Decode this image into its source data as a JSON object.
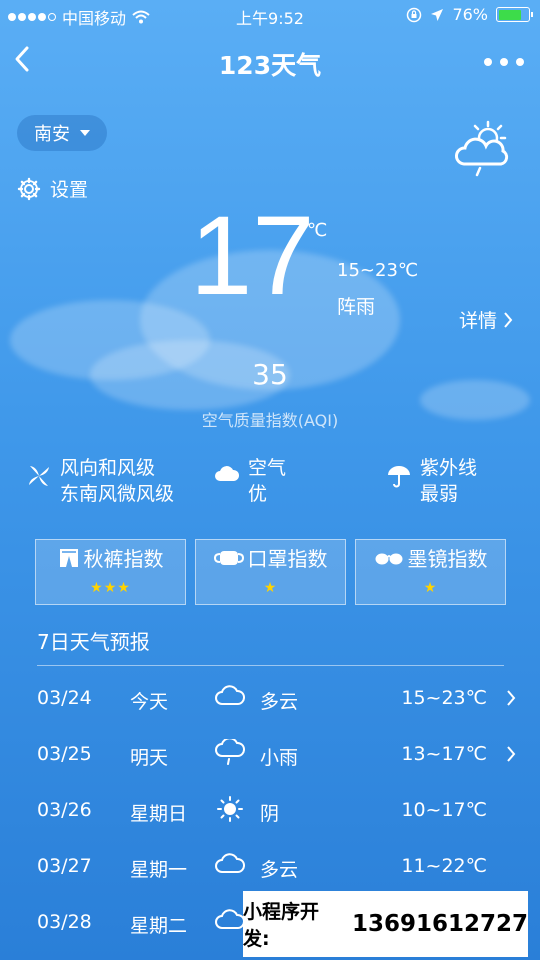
{
  "status_bar": {
    "carrier": "中国移动",
    "time": "上午9:52",
    "battery": "76%",
    "battery_level": 0.76
  },
  "nav": {
    "title": "123天气"
  },
  "current": {
    "city": "南安",
    "settings_label": "设置",
    "temperature": "17",
    "unit": "℃",
    "range": "15~23℃",
    "condition": "阵雨",
    "details_label": "详情",
    "aqi_value": "35",
    "aqi_label": "空气质量指数(AQI)"
  },
  "info": {
    "wind_title": "风向和风级",
    "wind_value": "东南风微风级",
    "air_title": "空气",
    "air_value": "优",
    "uv_title": "紫外线",
    "uv_value": "最弱"
  },
  "indices": [
    {
      "label": "秋裤指数",
      "stars": "★★★",
      "icon": "pants-icon"
    },
    {
      "label": "口罩指数",
      "stars": "★",
      "icon": "mask-icon"
    },
    {
      "label": "墨镜指数",
      "stars": "★",
      "icon": "sunglasses-icon"
    }
  ],
  "forecast": {
    "title": "7日天气预报",
    "days": [
      {
        "date": "03/24",
        "day": "今天",
        "weather": "多云",
        "temps": "15~23℃",
        "icon": "cloudy-icon",
        "has_detail": true
      },
      {
        "date": "03/25",
        "day": "明天",
        "weather": "小雨",
        "temps": "13~17℃",
        "icon": "light-rain-icon",
        "has_detail": true
      },
      {
        "date": "03/26",
        "day": "星期日",
        "weather": "阴",
        "temps": "10~17℃",
        "icon": "overcast-icon",
        "has_detail": false
      },
      {
        "date": "03/27",
        "day": "星期一",
        "weather": "多云",
        "temps": "11~22℃",
        "icon": "cloudy-icon",
        "has_detail": false
      },
      {
        "date": "03/28",
        "day": "星期二",
        "weather": "",
        "temps": "",
        "icon": "cloudy-icon",
        "has_detail": false
      }
    ]
  },
  "promo": {
    "label": "小程序开发:",
    "number": "13691612727"
  },
  "colors": {
    "bg_top": "#5aaef5",
    "bg_bottom": "#2a7fd8",
    "star": "#ffd300",
    "battery": "#3ddc4a"
  }
}
